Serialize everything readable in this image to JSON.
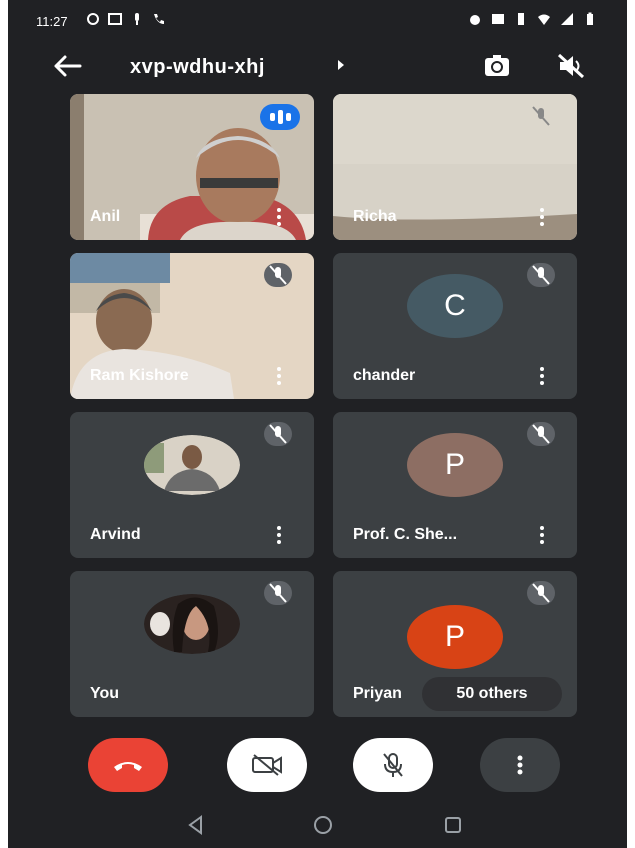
{
  "status_bar": {
    "time": "11:27"
  },
  "meeting": {
    "code": "xvp-wdhu-xhj"
  },
  "participants": [
    {
      "name": "Anil",
      "type": "video",
      "speaking": true
    },
    {
      "name": "Richa",
      "type": "video",
      "muted": true
    },
    {
      "name": "Ram Kishore",
      "type": "video",
      "muted": true
    },
    {
      "name": "chander",
      "type": "initial",
      "initial": "C",
      "avatar_color": "#455a64",
      "muted": true
    },
    {
      "name": "Arvind",
      "type": "photo",
      "muted": true
    },
    {
      "name": "Prof. C. She...",
      "type": "initial",
      "initial": "P",
      "avatar_color": "#8d6e63",
      "muted": true
    },
    {
      "name": "You",
      "type": "photo",
      "muted": true
    },
    {
      "name": "Priyan",
      "type": "initial",
      "initial": "P",
      "avatar_color": "#d84315",
      "muted": true
    }
  ],
  "others_badge": "50 others",
  "controls": {
    "end_call_color": "#ea4335"
  },
  "icons": [
    "back-arrow-icon",
    "camera-switch-icon",
    "audio-output-off-icon",
    "mic-off-icon",
    "more-vert-icon",
    "call-end-icon",
    "video-off-icon",
    "nav-back-icon",
    "nav-home-icon",
    "nav-recents-icon"
  ]
}
